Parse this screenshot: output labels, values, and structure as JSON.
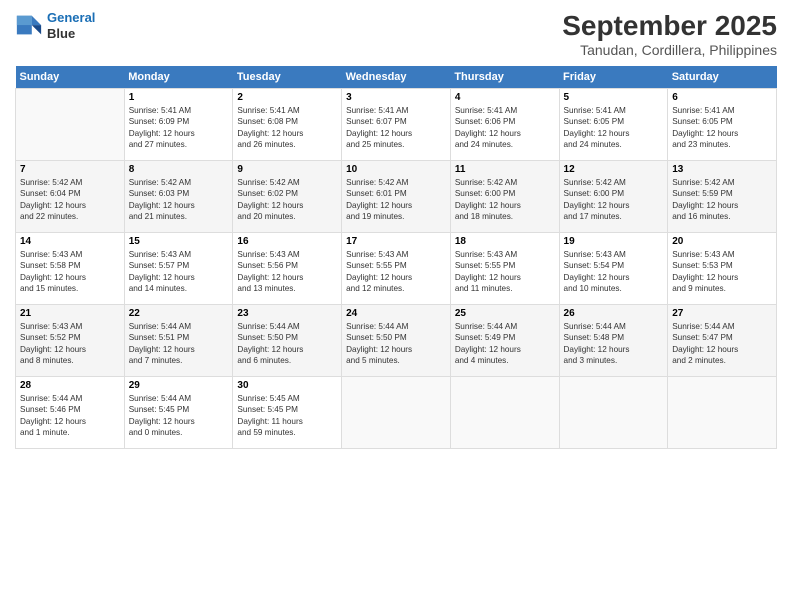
{
  "logo": {
    "line1": "General",
    "line2": "Blue"
  },
  "title": "September 2025",
  "subtitle": "Tanudan, Cordillera, Philippines",
  "days_of_week": [
    "Sunday",
    "Monday",
    "Tuesday",
    "Wednesday",
    "Thursday",
    "Friday",
    "Saturday"
  ],
  "weeks": [
    [
      {
        "day": "",
        "text": ""
      },
      {
        "day": "1",
        "text": "Sunrise: 5:41 AM\nSunset: 6:09 PM\nDaylight: 12 hours\nand 27 minutes."
      },
      {
        "day": "2",
        "text": "Sunrise: 5:41 AM\nSunset: 6:08 PM\nDaylight: 12 hours\nand 26 minutes."
      },
      {
        "day": "3",
        "text": "Sunrise: 5:41 AM\nSunset: 6:07 PM\nDaylight: 12 hours\nand 25 minutes."
      },
      {
        "day": "4",
        "text": "Sunrise: 5:41 AM\nSunset: 6:06 PM\nDaylight: 12 hours\nand 24 minutes."
      },
      {
        "day": "5",
        "text": "Sunrise: 5:41 AM\nSunset: 6:05 PM\nDaylight: 12 hours\nand 24 minutes."
      },
      {
        "day": "6",
        "text": "Sunrise: 5:41 AM\nSunset: 6:05 PM\nDaylight: 12 hours\nand 23 minutes."
      }
    ],
    [
      {
        "day": "7",
        "text": "Sunrise: 5:42 AM\nSunset: 6:04 PM\nDaylight: 12 hours\nand 22 minutes."
      },
      {
        "day": "8",
        "text": "Sunrise: 5:42 AM\nSunset: 6:03 PM\nDaylight: 12 hours\nand 21 minutes."
      },
      {
        "day": "9",
        "text": "Sunrise: 5:42 AM\nSunset: 6:02 PM\nDaylight: 12 hours\nand 20 minutes."
      },
      {
        "day": "10",
        "text": "Sunrise: 5:42 AM\nSunset: 6:01 PM\nDaylight: 12 hours\nand 19 minutes."
      },
      {
        "day": "11",
        "text": "Sunrise: 5:42 AM\nSunset: 6:00 PM\nDaylight: 12 hours\nand 18 minutes."
      },
      {
        "day": "12",
        "text": "Sunrise: 5:42 AM\nSunset: 6:00 PM\nDaylight: 12 hours\nand 17 minutes."
      },
      {
        "day": "13",
        "text": "Sunrise: 5:42 AM\nSunset: 5:59 PM\nDaylight: 12 hours\nand 16 minutes."
      }
    ],
    [
      {
        "day": "14",
        "text": "Sunrise: 5:43 AM\nSunset: 5:58 PM\nDaylight: 12 hours\nand 15 minutes."
      },
      {
        "day": "15",
        "text": "Sunrise: 5:43 AM\nSunset: 5:57 PM\nDaylight: 12 hours\nand 14 minutes."
      },
      {
        "day": "16",
        "text": "Sunrise: 5:43 AM\nSunset: 5:56 PM\nDaylight: 12 hours\nand 13 minutes."
      },
      {
        "day": "17",
        "text": "Sunrise: 5:43 AM\nSunset: 5:55 PM\nDaylight: 12 hours\nand 12 minutes."
      },
      {
        "day": "18",
        "text": "Sunrise: 5:43 AM\nSunset: 5:55 PM\nDaylight: 12 hours\nand 11 minutes."
      },
      {
        "day": "19",
        "text": "Sunrise: 5:43 AM\nSunset: 5:54 PM\nDaylight: 12 hours\nand 10 minutes."
      },
      {
        "day": "20",
        "text": "Sunrise: 5:43 AM\nSunset: 5:53 PM\nDaylight: 12 hours\nand 9 minutes."
      }
    ],
    [
      {
        "day": "21",
        "text": "Sunrise: 5:43 AM\nSunset: 5:52 PM\nDaylight: 12 hours\nand 8 minutes."
      },
      {
        "day": "22",
        "text": "Sunrise: 5:44 AM\nSunset: 5:51 PM\nDaylight: 12 hours\nand 7 minutes."
      },
      {
        "day": "23",
        "text": "Sunrise: 5:44 AM\nSunset: 5:50 PM\nDaylight: 12 hours\nand 6 minutes."
      },
      {
        "day": "24",
        "text": "Sunrise: 5:44 AM\nSunset: 5:50 PM\nDaylight: 12 hours\nand 5 minutes."
      },
      {
        "day": "25",
        "text": "Sunrise: 5:44 AM\nSunset: 5:49 PM\nDaylight: 12 hours\nand 4 minutes."
      },
      {
        "day": "26",
        "text": "Sunrise: 5:44 AM\nSunset: 5:48 PM\nDaylight: 12 hours\nand 3 minutes."
      },
      {
        "day": "27",
        "text": "Sunrise: 5:44 AM\nSunset: 5:47 PM\nDaylight: 12 hours\nand 2 minutes."
      }
    ],
    [
      {
        "day": "28",
        "text": "Sunrise: 5:44 AM\nSunset: 5:46 PM\nDaylight: 12 hours\nand 1 minute."
      },
      {
        "day": "29",
        "text": "Sunrise: 5:44 AM\nSunset: 5:45 PM\nDaylight: 12 hours\nand 0 minutes."
      },
      {
        "day": "30",
        "text": "Sunrise: 5:45 AM\nSunset: 5:45 PM\nDaylight: 11 hours\nand 59 minutes."
      },
      {
        "day": "",
        "text": ""
      },
      {
        "day": "",
        "text": ""
      },
      {
        "day": "",
        "text": ""
      },
      {
        "day": "",
        "text": ""
      }
    ]
  ]
}
